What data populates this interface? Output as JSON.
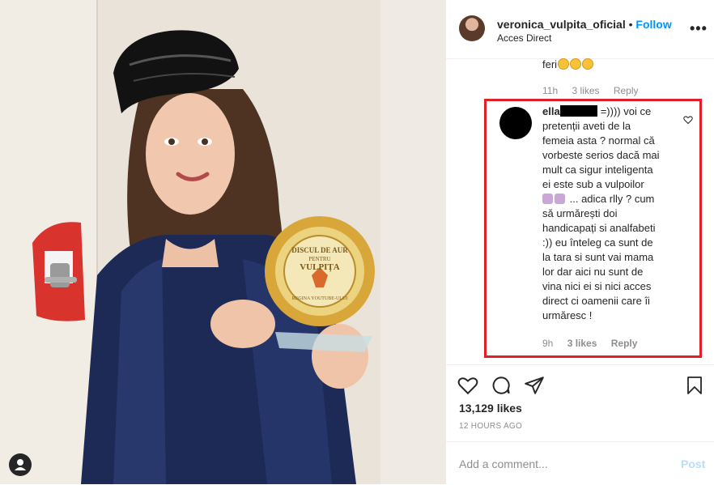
{
  "header": {
    "username": "veronica_vulpita_oficial",
    "separator": "•",
    "follow_label": "Follow",
    "location": "Acces Direct",
    "more_icon": "ellipsis-icon"
  },
  "previous_comment": {
    "text": "feri",
    "emoji_count": 3,
    "time": "11h",
    "likes": "3 likes",
    "reply": "Reply"
  },
  "highlighted_comment": {
    "username": "ella",
    "text_lines": [
      "=)))) voi ce",
      "pretenții aveti de la",
      "femeia asta ? normal că",
      "vorbeste serios dacă mai",
      "mult ca sigur inteligenta",
      "ei este sub a vulpoilor",
      "... adica rlly ? cum",
      "să urmărești doi",
      "handicapați si analfabeti",
      ":)) eu înteleg ca sunt de",
      "la tara si sunt vai mama",
      "lor dar aici nu sunt de",
      "vina nici ei si nici acces",
      "direct ci oamenii care îi",
      "urmăresc !"
    ],
    "time": "9h",
    "likes": "3 likes",
    "reply": "Reply",
    "highlight_color": "#e41e26"
  },
  "likes_count": "13,129 likes",
  "timestamp": "12 HOURS AGO",
  "add_comment": {
    "placeholder": "Add a comment...",
    "post_label": "Post"
  },
  "photo": {
    "trophy_lines": [
      "DISCUL DE AUR",
      "PENTRU",
      "VULPIȚA",
      "REGINA YOUTUBE-ULUI"
    ]
  },
  "colors": {
    "link_blue": "#0095f6",
    "post_disabled": "#b2dffc",
    "text": "#262626",
    "muted": "#8e8e8e"
  }
}
